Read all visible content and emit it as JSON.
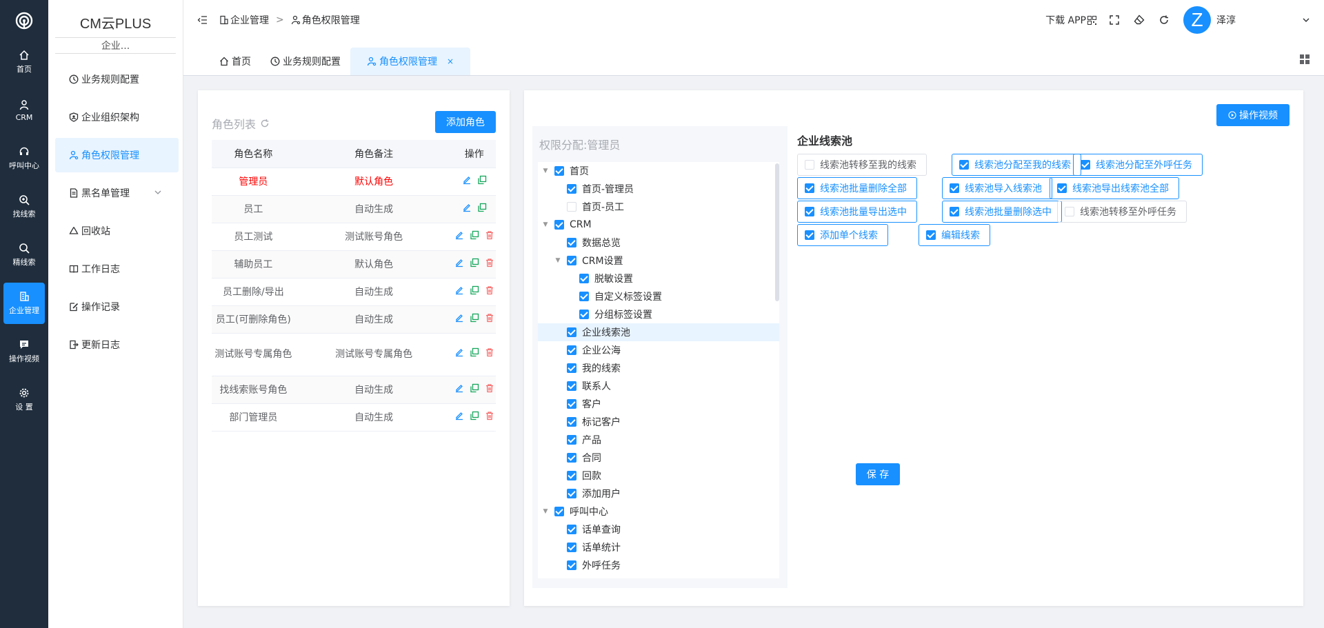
{
  "rail": {
    "items": [
      {
        "label": "首页",
        "icon": "home-icon"
      },
      {
        "label": "CRM",
        "icon": "user-icon"
      },
      {
        "label": "呼叫中心",
        "icon": "headset-icon"
      },
      {
        "label": "找线索",
        "icon": "search-plus-icon"
      },
      {
        "label": "精线索",
        "icon": "search-icon"
      },
      {
        "label": "企业管理",
        "icon": "building-icon",
        "active": true
      },
      {
        "label": "操作视频",
        "icon": "chat-icon"
      },
      {
        "label": "设 置",
        "icon": "gear-icon"
      }
    ]
  },
  "sidebar": {
    "brand": "CM云PLUS",
    "company": "企业...",
    "items": [
      {
        "label": "业务规则配置"
      },
      {
        "label": "企业组织架构"
      },
      {
        "label": "角色权限管理",
        "active": true
      },
      {
        "label": "黑名单管理"
      },
      {
        "label": "回收站"
      },
      {
        "label": "工作日志"
      },
      {
        "label": "操作记录"
      },
      {
        "label": "更新日志"
      }
    ]
  },
  "header": {
    "breadcrumb": [
      "企业管理",
      "角色权限管理"
    ],
    "download": "下载 APP",
    "avatar_letter": "Z",
    "username": "泽淳"
  },
  "tabs": [
    {
      "label": "首页"
    },
    {
      "label": "业务规则配置"
    },
    {
      "label": "角色权限管理",
      "active": true,
      "close": "×"
    }
  ],
  "roles": {
    "title": "角色列表",
    "add_button": "添加角色",
    "columns": [
      "角色名称",
      "角色备注",
      "操作"
    ],
    "rows": [
      {
        "name": "管理员",
        "note": "默认角色"
      },
      {
        "name": "员工",
        "note": "自动生成"
      },
      {
        "name": "员工测试",
        "note": "测试账号角色"
      },
      {
        "name": "辅助员工",
        "note": "默认角色"
      },
      {
        "name": "员工删除/导出",
        "note": "自动生成"
      },
      {
        "name": "员工(可删除角色)",
        "note": "自动生成"
      },
      {
        "name": "测试账号专属角色",
        "note": "测试账号专属角色"
      },
      {
        "name": "找线索账号角色",
        "note": "自动生成"
      },
      {
        "name": "部门管理员",
        "note": "自动生成"
      }
    ]
  },
  "tree": {
    "title": "权限分配:管理员",
    "nodes": [
      {
        "label": "首页",
        "level": 0,
        "caret": true,
        "checked": true
      },
      {
        "label": "首页-管理员",
        "level": 1,
        "checked": true
      },
      {
        "label": "首页-员工",
        "level": 1,
        "checked": false
      },
      {
        "label": "CRM",
        "level": 0,
        "caret": true,
        "checked": true
      },
      {
        "label": "数据总览",
        "level": 1,
        "checked": true
      },
      {
        "label": "CRM设置",
        "level": 1,
        "caret": true,
        "checked": true
      },
      {
        "label": "脱敏设置",
        "level": 2,
        "checked": true
      },
      {
        "label": "自定义标签设置",
        "level": 2,
        "checked": true
      },
      {
        "label": "分组标签设置",
        "level": 2,
        "checked": true
      },
      {
        "label": "企业线索池",
        "level": 1,
        "checked": true,
        "selected": true
      },
      {
        "label": "企业公海",
        "level": 1,
        "checked": true
      },
      {
        "label": "我的线索",
        "level": 1,
        "checked": true
      },
      {
        "label": "联系人",
        "level": 1,
        "checked": true
      },
      {
        "label": "客户",
        "level": 1,
        "checked": true
      },
      {
        "label": "标记客户",
        "level": 1,
        "checked": true
      },
      {
        "label": "产品",
        "level": 1,
        "checked": true
      },
      {
        "label": "合同",
        "level": 1,
        "checked": true
      },
      {
        "label": "回款",
        "level": 1,
        "checked": true
      },
      {
        "label": "添加用户",
        "level": 1,
        "checked": true
      },
      {
        "label": "呼叫中心",
        "level": 0,
        "caret": true,
        "checked": true
      },
      {
        "label": "话单查询",
        "level": 1,
        "checked": true
      },
      {
        "label": "话单统计",
        "level": 1,
        "checked": true
      },
      {
        "label": "外呼任务",
        "level": 1,
        "checked": true
      }
    ]
  },
  "pool": {
    "video_button": "操作视频",
    "title": "企业线索池",
    "save_button": "保 存",
    "permissions": [
      {
        "label": "线索池转移至我的线索",
        "checked": false
      },
      {
        "label": "线索池分配至我的线索",
        "checked": true
      },
      {
        "label": "线索池分配至外呼任务",
        "checked": true
      },
      {
        "label": "线索池批量删除全部",
        "checked": true
      },
      {
        "label": "线索池导入线索池",
        "checked": true
      },
      {
        "label": "线索池导出线索池全部",
        "checked": true
      },
      {
        "label": "线索池批量导出选中",
        "checked": true
      },
      {
        "label": "线索池批量删除选中",
        "checked": true
      },
      {
        "label": "线索池转移至外呼任务",
        "checked": false
      },
      {
        "label": "添加单个线索",
        "checked": true
      },
      {
        "label": "编辑线索",
        "checked": true
      }
    ]
  },
  "colors": {
    "primary": "#1890ff",
    "rail": "#1f2d3d",
    "danger": "#f56c6c",
    "success": "#13a65a"
  }
}
